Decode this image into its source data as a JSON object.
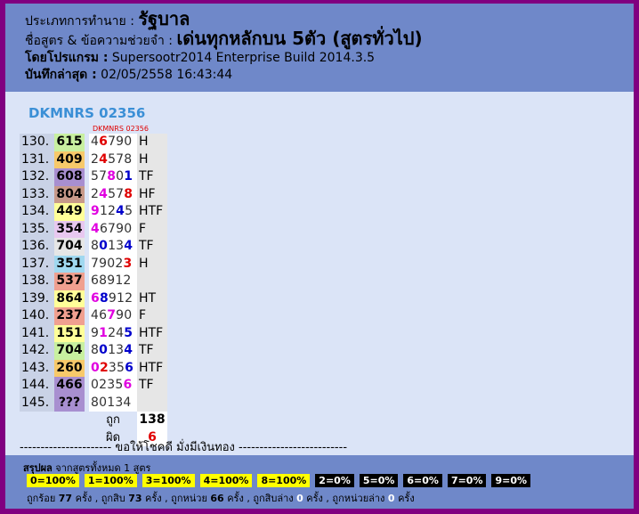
{
  "header": {
    "type_label": "ประเภทการทำนาย :",
    "type_value": "รัฐบาล",
    "formula_label": "ชื่อสูตร & ข้อความช่วยจำ :",
    "formula_value": "เด่นทุกหลักบน 5ตัว (สูตรทั่วไป)",
    "program_label": "โดยโปรแกรม :",
    "program_value": "Supersootr2014 Enterprise Build 2014.3.5",
    "saved_label": "บันทึกล่าสุด :",
    "saved_value": "02/05/2558 16:43:44"
  },
  "brand": "DKMNRS 02356",
  "mini_label": "DKMNRS 02356",
  "rows": [
    {
      "num": "130.",
      "val": "615",
      "bg": "#c8f0a0",
      "digits": [
        [
          "4",
          "n"
        ],
        [
          "6",
          "r"
        ],
        [
          "790",
          "n"
        ]
      ],
      "tag": "H"
    },
    {
      "num": "131.",
      "val": "409",
      "bg": "#f7c96a",
      "digits": [
        [
          "2",
          "n"
        ],
        [
          "4",
          "r"
        ],
        [
          "578",
          "n"
        ]
      ],
      "tag": "H"
    },
    {
      "num": "132.",
      "val": "608",
      "bg": "#a88fd0",
      "digits": [
        [
          "57",
          "n"
        ],
        [
          "8",
          "m"
        ],
        [
          "0",
          "n"
        ],
        [
          "1",
          "b"
        ]
      ],
      "tag": "TF"
    },
    {
      "num": "133.",
      "val": "804",
      "bg": "#c89a8a",
      "digits": [
        [
          "2",
          "n"
        ],
        [
          "4",
          "m"
        ],
        [
          "57",
          "n"
        ],
        [
          "8",
          "r"
        ]
      ],
      "tag": "HF"
    },
    {
      "num": "134.",
      "val": "449",
      "bg": "#ffff99",
      "digits": [
        [
          "9",
          "m"
        ],
        [
          "12",
          "n"
        ],
        [
          "4",
          "b"
        ],
        [
          "5",
          "n"
        ]
      ],
      "tag": "HTF"
    },
    {
      "num": "135.",
      "val": "354",
      "bg": "#e8c8f0",
      "digits": [
        [
          "4",
          "m"
        ],
        [
          "6790",
          "n"
        ]
      ],
      "tag": "F"
    },
    {
      "num": "136.",
      "val": "704",
      "bg": "#e6e6e6",
      "digits": [
        [
          "8",
          "n"
        ],
        [
          "0",
          "b"
        ],
        [
          "13",
          "n"
        ],
        [
          "4",
          "b"
        ]
      ],
      "tag": "TF"
    },
    {
      "num": "137.",
      "val": "351",
      "bg": "#a0d8f0",
      "digits": [
        [
          "7902",
          "n"
        ],
        [
          "3",
          "r"
        ]
      ],
      "tag": "H"
    },
    {
      "num": "138.",
      "val": "537",
      "bg": "#f0a090",
      "digits": [
        [
          "68912",
          "n"
        ]
      ],
      "tag": ""
    },
    {
      "num": "139.",
      "val": "864",
      "bg": "#ffff99",
      "digits": [
        [
          "6",
          "m"
        ],
        [
          "8",
          "b"
        ],
        [
          "912",
          "n"
        ]
      ],
      "tag": "HT"
    },
    {
      "num": "140.",
      "val": "237",
      "bg": "#f0a090",
      "digits": [
        [
          "46",
          "n"
        ],
        [
          "7",
          "m"
        ],
        [
          "90",
          "n"
        ]
      ],
      "tag": "F"
    },
    {
      "num": "141.",
      "val": "151",
      "bg": "#ffff99",
      "digits": [
        [
          "9",
          "n"
        ],
        [
          "1",
          "m"
        ],
        [
          "24",
          "n"
        ],
        [
          "5",
          "b"
        ]
      ],
      "tag": "HTF"
    },
    {
      "num": "142.",
      "val": "704",
      "bg": "#c8f0a0",
      "digits": [
        [
          "8",
          "n"
        ],
        [
          "0",
          "b"
        ],
        [
          "13",
          "n"
        ],
        [
          "4",
          "b"
        ]
      ],
      "tag": "TF"
    },
    {
      "num": "143.",
      "val": "260",
      "bg": "#f7c96a",
      "digits": [
        [
          "0",
          "m"
        ],
        [
          "2",
          "r"
        ],
        [
          "35",
          "n"
        ],
        [
          "6",
          "b"
        ]
      ],
      "tag": "HTF"
    },
    {
      "num": "144.",
      "val": "466",
      "bg": "#a88fd0",
      "digits": [
        [
          "0235",
          "n"
        ],
        [
          "6",
          "m"
        ]
      ],
      "tag": "TF"
    },
    {
      "num": "145.",
      "val": "???",
      "bg": "#a88fd0",
      "digits": [
        [
          "80134",
          "n"
        ]
      ],
      "tag": ""
    }
  ],
  "summary": {
    "correct_label": "ถูก",
    "correct_value": "138",
    "wrong_label": "ผิด",
    "wrong_value": "6"
  },
  "dash_line": "---------------------- ขอให้โชคดี มั่งมีเงินทอง --------------------------",
  "footer": {
    "title_bold": "สรุปผล",
    "title_rest": " จากสูตรทั้งหมด 1 สูตร",
    "badges": [
      {
        "text": "0=100%",
        "style": "y"
      },
      {
        "text": "1=100%",
        "style": "y"
      },
      {
        "text": "3=100%",
        "style": "y"
      },
      {
        "text": "4=100%",
        "style": "y"
      },
      {
        "text": "8=100%",
        "style": "y"
      },
      {
        "text": "2=0%",
        "style": "k"
      },
      {
        "text": "5=0%",
        "style": "k"
      },
      {
        "text": "6=0%",
        "style": "k"
      },
      {
        "text": "7=0%",
        "style": "k"
      },
      {
        "text": "9=0%",
        "style": "k"
      }
    ],
    "stats": [
      {
        "label": "ถูกร้อย ",
        "value": "77",
        "suffix": " ครั้ง , ",
        "white": false
      },
      {
        "label": "ถูกสิบ ",
        "value": "73",
        "suffix": " ครั้ง , ",
        "white": false
      },
      {
        "label": "ถูกหน่วย ",
        "value": "66",
        "suffix": " ครั้ง , ",
        "white": false
      },
      {
        "label": "ถูกสิบล่าง ",
        "value": "0",
        "suffix": " ครั้ง , ",
        "white": true
      },
      {
        "label": "ถูกหน่วยล่าง ",
        "value": "0",
        "suffix": " ครั้ง",
        "white": true
      }
    ]
  }
}
